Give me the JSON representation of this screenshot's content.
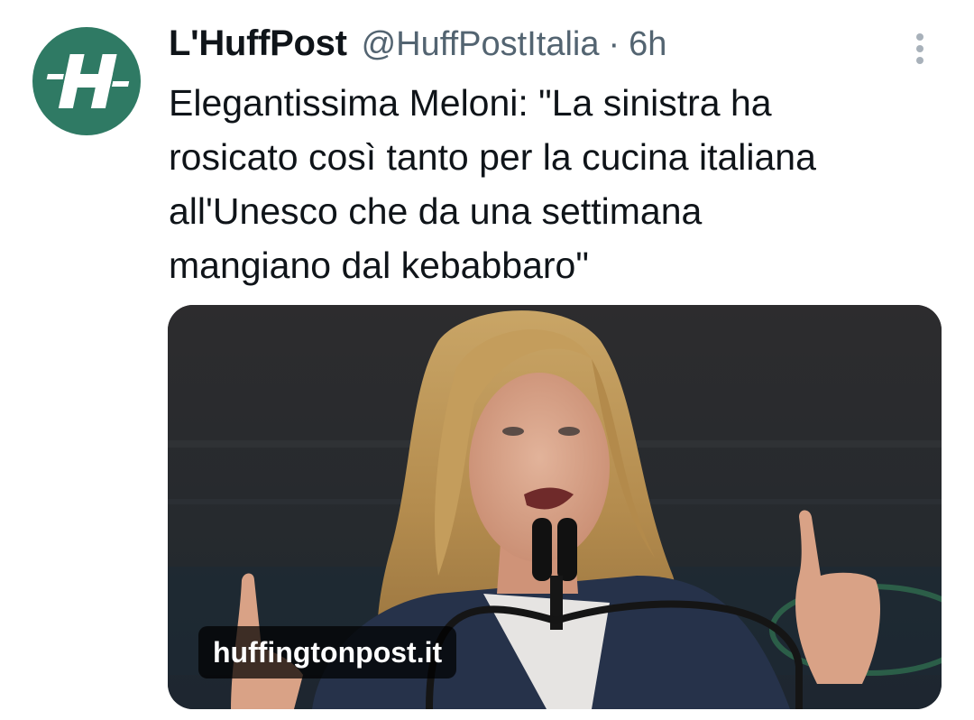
{
  "tweet": {
    "author_name": "L'HuffPost",
    "author_handle": "@HuffPostItalia",
    "separator": "·",
    "time": "6h",
    "avatar_letter": "H",
    "text": "Elegantissima Meloni: \"La sinistra ha\nrosicato così tanto per la cucina italiana\nall'Unesco che da una settimana\nmangiano dal kebabbaro\""
  },
  "media": {
    "link_domain": "huffingtonpost.it"
  },
  "icons": {
    "more": "more-vertical-icon"
  },
  "colors": {
    "avatar_bg": "#2f7a64",
    "text": "#0f1419",
    "secondary_text": "#536471"
  }
}
